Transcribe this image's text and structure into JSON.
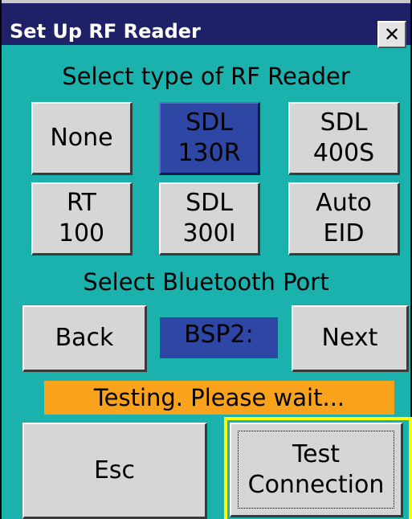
{
  "window": {
    "title": "Set Up RF Reader",
    "close_label": "✕"
  },
  "reader_section": {
    "heading": "Select type of RF Reader",
    "options": [
      {
        "label": "None",
        "selected": false
      },
      {
        "label": "SDL\n130R",
        "selected": true
      },
      {
        "label": "SDL\n400S",
        "selected": false
      },
      {
        "label": "RT\n100",
        "selected": false
      },
      {
        "label": "SDL\n300I",
        "selected": false
      },
      {
        "label": "Auto\nEID",
        "selected": false
      }
    ]
  },
  "port_section": {
    "heading": "Select Bluetooth Port",
    "back_label": "Back",
    "port_value": "BSP2:",
    "next_label": "Next"
  },
  "status": {
    "text": "Testing. Please wait..."
  },
  "actions": {
    "esc_label": "Esc",
    "test_label": "Test\nConnection"
  },
  "colors": {
    "background": "#1bb1ac",
    "titlebar": "#1e2068",
    "selected": "#2e47a5",
    "status": "#f9a31d",
    "focus_ring": "#ffff00"
  }
}
